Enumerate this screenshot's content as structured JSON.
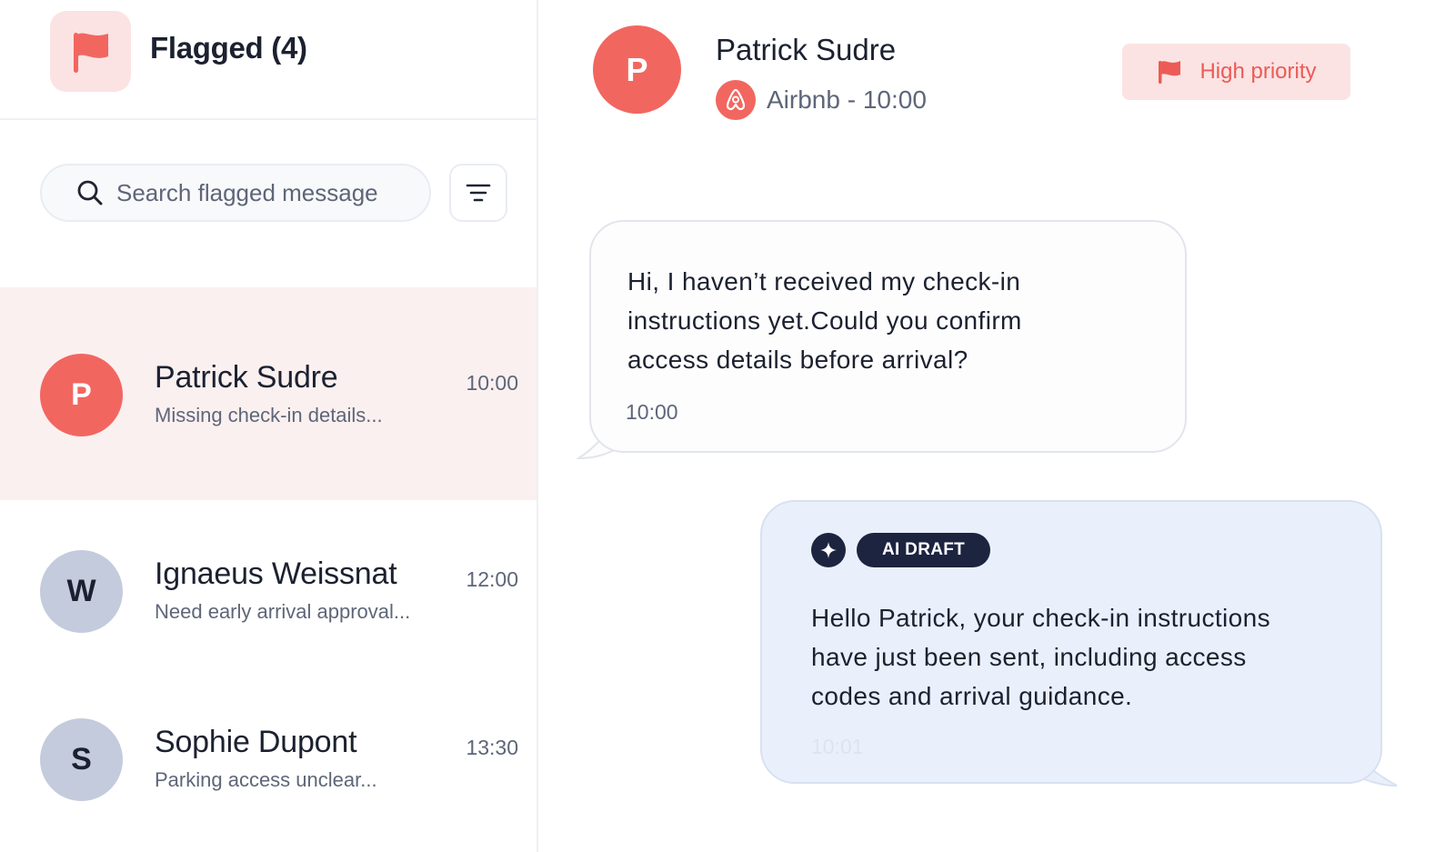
{
  "sidebar": {
    "title": "Flagged (4)",
    "search_placeholder": "Search flagged message",
    "conversations": [
      {
        "initial": "P",
        "name": "Patrick Sudre",
        "preview": "Missing check-in details...",
        "time": "10:00",
        "active": true,
        "avatar_color": "#f26660"
      },
      {
        "initial": "W",
        "name": "Ignaeus Weissnat",
        "preview": "Need early arrival approval...",
        "time": "12:00",
        "active": false,
        "avatar_color": "#c4cbdd"
      },
      {
        "initial": "S",
        "name": "Sophie Dupont",
        "preview": "Parking access unclear...",
        "time": "13:30",
        "active": false,
        "avatar_color": "#c4cbdd"
      }
    ]
  },
  "conversation": {
    "initial": "P",
    "name": "Patrick Sudre",
    "source": "Airbnb - 10:00",
    "priority_label": "High priority",
    "incoming": {
      "lines": [
        "Hi, I haven’t received my check-in",
        "instructions yet.Could you confirm",
        "access details before arrival?"
      ],
      "time": "10:00"
    },
    "draft": {
      "badge": "AI DRAFT",
      "lines": [
        "Hello Patrick, your check-in instructions",
        "have just been sent, including access",
        "codes and arrival guidance."
      ],
      "time": "10:01"
    }
  },
  "colors": {
    "accent_red": "#f26660",
    "priority_bg": "#fbe3e3",
    "draft_bg": "#eaf0fb",
    "navy": "#1c2440"
  },
  "icons": {
    "header_flag": "flag-icon",
    "search": "search-icon",
    "filter": "filter-icon",
    "source": "airbnb-icon",
    "priority": "flag-icon",
    "draft": "sparkle-icon"
  }
}
